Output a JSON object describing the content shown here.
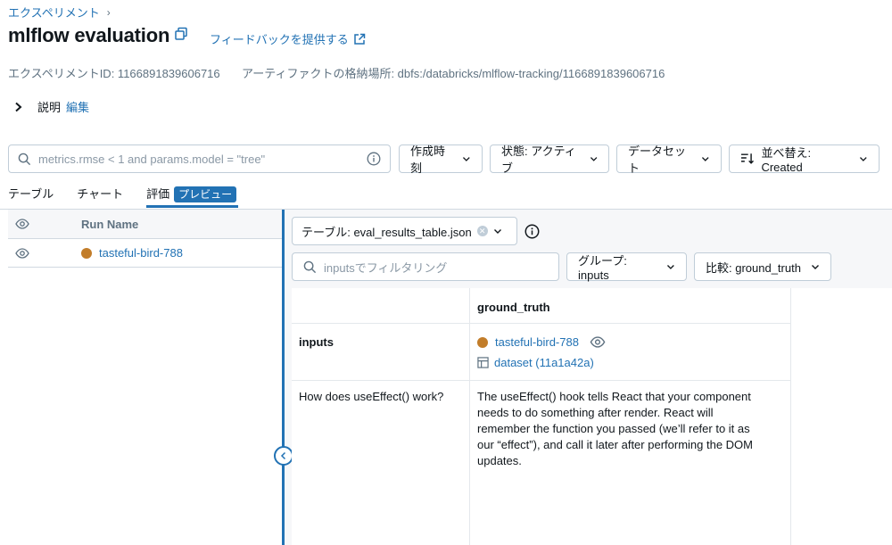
{
  "breadcrumb": {
    "label": "エクスペリメント",
    "sep": "›"
  },
  "page": {
    "title": "mlflow evaluation",
    "feedback": "フィードバックを提供する"
  },
  "meta": {
    "experiment_id": "エクスペリメントID: 1166891839606716",
    "artifact_location": "アーティファクトの格納場所: dbfs:/databricks/mlflow-tracking/1166891839606716"
  },
  "description": {
    "label": "説明",
    "edit": "編集"
  },
  "toolbar": {
    "search_placeholder": "metrics.rmse < 1 and params.model = \"tree\"",
    "created_time": "作成時刻",
    "state": "状態: アクティブ",
    "dataset": "データセット",
    "sort": "並べ替え: Created"
  },
  "tabs": {
    "table": "テーブル",
    "chart": "チャート",
    "evaluation": "評価",
    "preview_badge": "プレビュー"
  },
  "runs_table": {
    "header": "Run Name",
    "runs": [
      {
        "name": "tasteful-bird-788",
        "color": "#c27d2a"
      }
    ]
  },
  "eval_panel": {
    "table_select": "テーブル: eval_results_table.json",
    "filter_placeholder": "inputsでフィルタリング",
    "group": "グループ: inputs",
    "compare": "比較: ground_truth",
    "column_header": "ground_truth",
    "row_header": "inputs",
    "run_name": "tasteful-bird-788",
    "dataset_link": "dataset (11a1a42a)",
    "input_text": "How does useEffect() work?",
    "output_lines": [
      "The useEffect() hook tells React that your component",
      "needs to do something after render. React will",
      "remember the function you passed (we’ll refer to it as",
      "our “effect”), and call it later after performing the DOM",
      "updates."
    ]
  }
}
